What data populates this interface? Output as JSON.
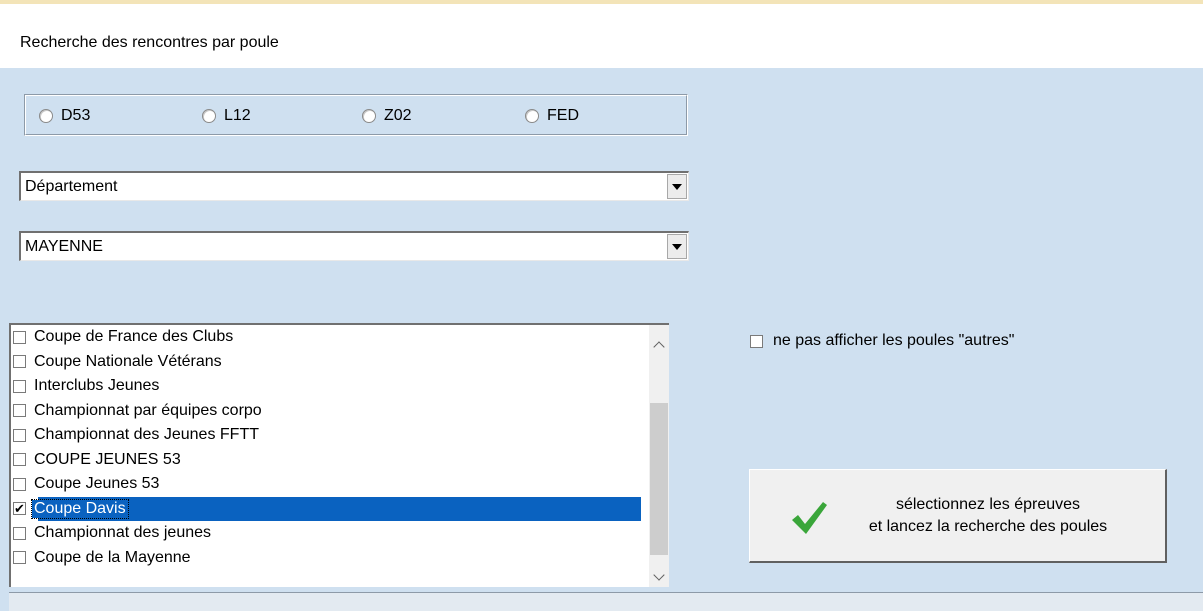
{
  "header": {
    "title": "Recherche des rencontres par poule"
  },
  "radios": [
    {
      "label": "D53",
      "checked": false
    },
    {
      "label": "L12",
      "checked": false
    },
    {
      "label": "Z02",
      "checked": false
    },
    {
      "label": "FED",
      "checked": false
    }
  ],
  "level_select": {
    "value": "Département"
  },
  "region_select": {
    "value": "MAYENNE"
  },
  "competitions": [
    {
      "label": "Coupe de France des Clubs",
      "checked": false
    },
    {
      "label": "Coupe Nationale Vétérans",
      "checked": false
    },
    {
      "label": "Interclubs Jeunes",
      "checked": false
    },
    {
      "label": "Championnat par équipes corpo",
      "checked": false
    },
    {
      "label": "Championnat des Jeunes FFTT",
      "checked": false
    },
    {
      "label": "COUPE JEUNES 53",
      "checked": false
    },
    {
      "label": "Coupe Jeunes 53",
      "checked": false
    },
    {
      "label": "Coupe Davis",
      "checked": true,
      "selected": true
    },
    {
      "label": "Championnat des jeunes",
      "checked": false
    },
    {
      "label": "Coupe de la Mayenne",
      "checked": false
    }
  ],
  "option": {
    "label": "ne pas afficher les poules \"autres\"",
    "checked": false
  },
  "action": {
    "line1": "sélectionnez les épreuves",
    "line2": "et lancez la recherche des poules",
    "icon_color": "#3aa63a"
  }
}
